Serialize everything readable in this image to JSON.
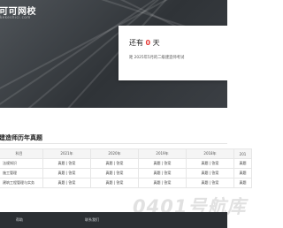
{
  "site": {
    "logo_text": "可可网校",
    "logo_sub": "kekeshici.com"
  },
  "countdown": {
    "prefix": "还有",
    "days": "0",
    "suffix": "天",
    "subtitle": "距 2025年5月的二级建造师考试"
  },
  "section": {
    "title": "建造师历年真题"
  },
  "table": {
    "headers": [
      "科目",
      "2021年",
      "2020年",
      "2019年",
      "2018年",
      "201"
    ],
    "rows": [
      {
        "subject": "法规知识",
        "cells": [
          "真题 | 答案",
          "真题 | 答案",
          "真题 | 答案",
          "真题 | 答案",
          "真题"
        ]
      },
      {
        "subject": "施工管理",
        "cells": [
          "真题 | 答案",
          "真题 | 答案",
          "真题 | 答案",
          "真题 | 答案",
          "真题"
        ]
      },
      {
        "subject": "建筑工程管理与实务",
        "cells": [
          "真题 | 答案",
          "真题 | 答案",
          "真题 | 答案",
          "真题 | 答案",
          "真题"
        ]
      }
    ]
  },
  "footer": {
    "col1": "帮助",
    "col2": "联系我们"
  },
  "watermark": "0401号航库",
  "colors": {
    "accent": "#e53935",
    "hero_bg": "#33373b",
    "footer_bg": "#2b2f33"
  }
}
